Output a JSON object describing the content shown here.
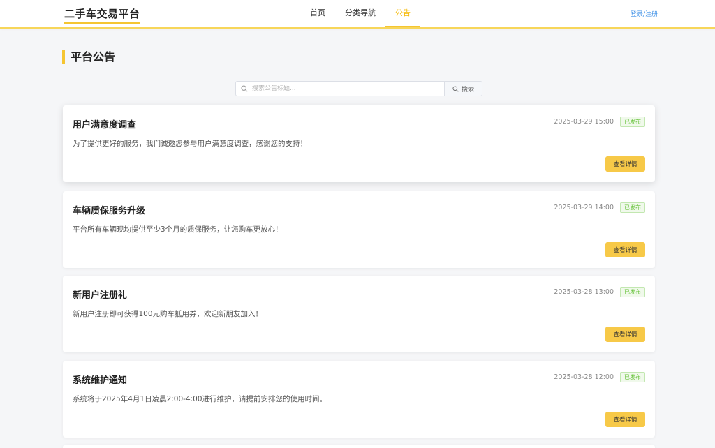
{
  "header": {
    "logo": "二手车交易平台",
    "nav": [
      {
        "label": "首页",
        "active": false
      },
      {
        "label": "分类导航",
        "active": false
      },
      {
        "label": "公告",
        "active": true
      }
    ],
    "login_label": "登录/注册"
  },
  "page": {
    "title": "平台公告"
  },
  "search": {
    "placeholder": "搜索公告标题...",
    "button_label": "搜索"
  },
  "announcements": [
    {
      "title": "用户满意度调查",
      "date": "2025-03-29 15:00",
      "status": "已发布",
      "content": "为了提供更好的服务，我们诚邀您参与用户满意度调查，感谢您的支持！",
      "button": "查看详情"
    },
    {
      "title": "车辆质保服务升级",
      "date": "2025-03-29 14:00",
      "status": "已发布",
      "content": "平台所有车辆现均提供至少3个月的质保服务，让您购车更放心！",
      "button": "查看详情"
    },
    {
      "title": "新用户注册礼",
      "date": "2025-03-28 13:00",
      "status": "已发布",
      "content": "新用户注册即可获得100元购车抵用券，欢迎新朋友加入！",
      "button": "查看详情"
    },
    {
      "title": "系统维护通知",
      "date": "2025-03-28 12:00",
      "status": "已发布",
      "content": "系统将于2025年4月1日凌晨2:00-4:00进行维护，请提前安排您的使用时间。",
      "button": "查看详情"
    }
  ],
  "colors": {
    "accent": "#f5c531",
    "button": "#f7c948",
    "status": "#67c23a",
    "link": "#3a8ee6"
  }
}
